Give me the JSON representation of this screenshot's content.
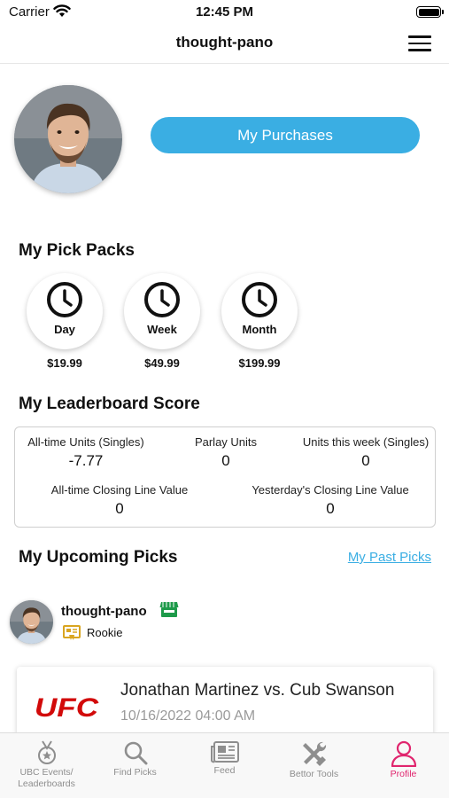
{
  "status_bar": {
    "carrier": "Carrier",
    "time": "12:45 PM"
  },
  "nav": {
    "title": "thought-pano"
  },
  "profile": {
    "purchases_label": "My Purchases"
  },
  "pick_packs": {
    "title": "My Pick Packs",
    "items": [
      {
        "label": "Day",
        "price": "$19.99",
        "icon": "clock-icon"
      },
      {
        "label": "Week",
        "price": "$49.99",
        "icon": "clock-icon"
      },
      {
        "label": "Month",
        "price": "$199.99",
        "icon": "clock-icon"
      }
    ]
  },
  "leaderboard": {
    "title": "My Leaderboard Score",
    "alltime_units": {
      "label": "All-time Units (Singles)",
      "value": "-7.77"
    },
    "parlay_units": {
      "label": "Parlay Units",
      "value": "0"
    },
    "week_units": {
      "label": "Units this week (Singles)",
      "value": "0"
    },
    "alltime_clv": {
      "label": "All-time Closing Line Value",
      "value": "0"
    },
    "yesterday_clv": {
      "label": "Yesterday's Closing Line Value",
      "value": "0"
    }
  },
  "upcoming": {
    "title": "My Upcoming Picks",
    "past_link": "My Past Picks",
    "user": {
      "name": "thought-pano",
      "rank": "Rookie"
    },
    "pick": {
      "logo_text": "UFC",
      "matchup": "Jonathan Martinez vs. Cub Swanson",
      "date": "10/16/2022 04:00 AM"
    }
  },
  "tabs": [
    {
      "label_line1": "UBC Events/",
      "label_line2": "Leaderboards",
      "icon": "medal-icon"
    },
    {
      "label_line1": "Find Picks",
      "label_line2": "",
      "icon": "search-icon"
    },
    {
      "label_line1": "Feed",
      "label_line2": "",
      "icon": "newspaper-icon"
    },
    {
      "label_line1": "Bettor Tools",
      "label_line2": "",
      "icon": "tools-icon"
    },
    {
      "label_line1": "Profile",
      "label_line2": "",
      "icon": "profile-icon"
    }
  ],
  "colors": {
    "accent": "#3aaee3",
    "active_tab": "#e0256e",
    "shop_badge": "#1e9a4a",
    "ufc_red": "#d20a0a"
  }
}
